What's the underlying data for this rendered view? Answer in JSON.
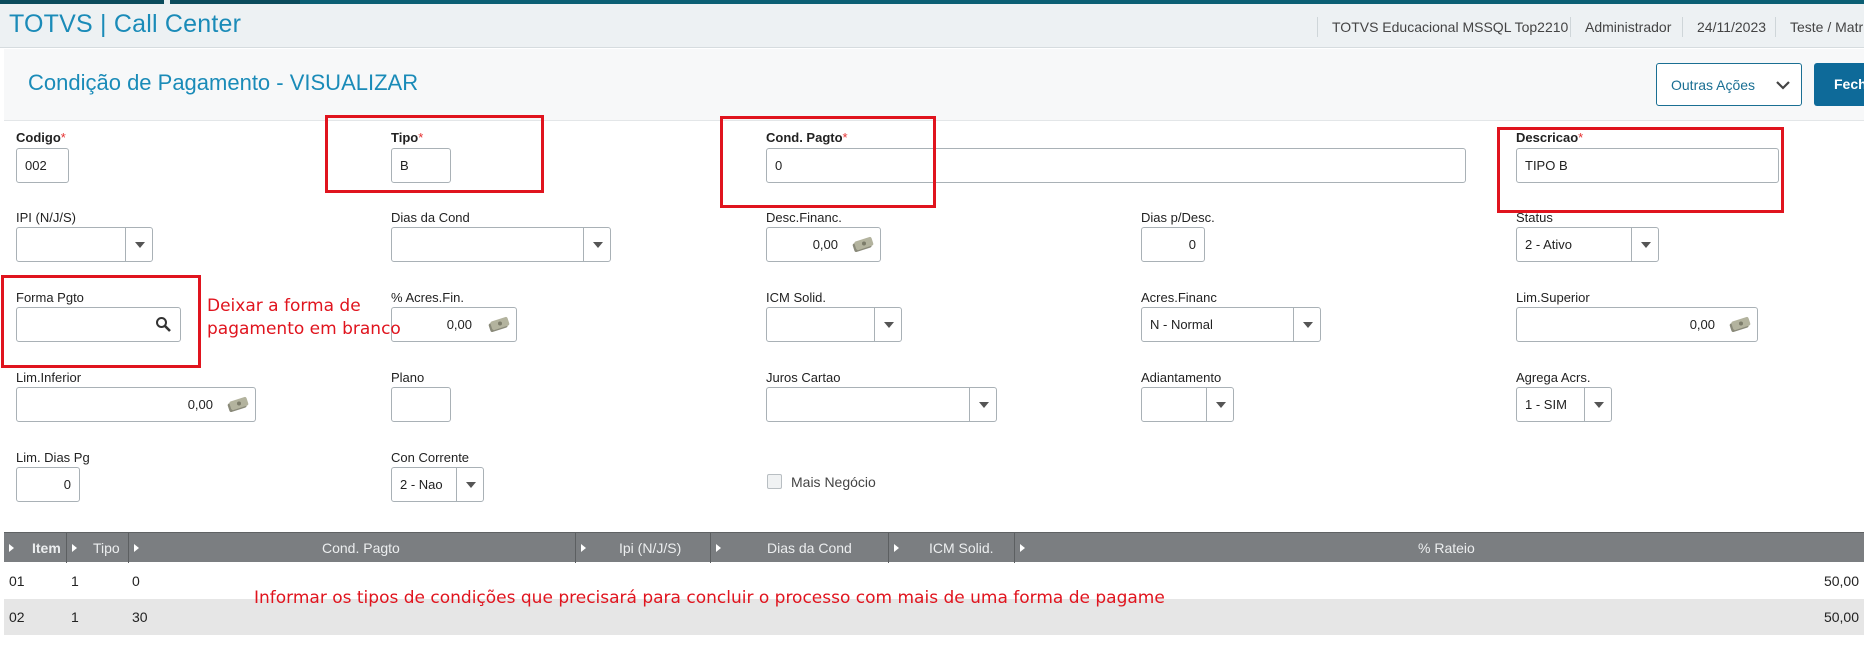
{
  "app": {
    "title": "TOTVS | Call Center",
    "environment": "TOTVS Educacional MSSQL Top2210",
    "user": "Administrador",
    "date": "24/11/2023",
    "branch": "Teste / Matri"
  },
  "page": {
    "title": "Condição de Pagamento - VISUALIZAR",
    "outras_acoes_label": "Outras Ações",
    "fechar_label": "Fechar"
  },
  "form": {
    "codigo": {
      "label": "Codigo",
      "value": "002"
    },
    "tipo": {
      "label": "Tipo",
      "value": "B"
    },
    "cond_pagto": {
      "label": "Cond. Pagto",
      "value": "0"
    },
    "descricao": {
      "label": "Descricao",
      "value": "TIPO B"
    },
    "ipi": {
      "label": "IPI (N/J/S)",
      "value": ""
    },
    "dias_cond": {
      "label": "Dias da Cond",
      "value": ""
    },
    "desc_financ": {
      "label": "Desc.Financ.",
      "value": "0,00"
    },
    "dias_desc": {
      "label": "Dias p/Desc.",
      "value": "0"
    },
    "status": {
      "label": "Status",
      "value": "2 - Ativo"
    },
    "forma_pgto": {
      "label": "Forma Pgto",
      "value": ""
    },
    "acres_fin": {
      "label": "% Acres.Fin.",
      "value": "0,00"
    },
    "icm_solid": {
      "label": "ICM Solid.",
      "value": ""
    },
    "acres_financ": {
      "label": "Acres.Financ",
      "value": "N - Normal"
    },
    "lim_superior": {
      "label": "Lim.Superior",
      "value": "0,00"
    },
    "lim_inferior": {
      "label": "Lim.Inferior",
      "value": "0,00"
    },
    "plano": {
      "label": "Plano",
      "value": ""
    },
    "juros_cartao": {
      "label": "Juros Cartao",
      "value": ""
    },
    "adiantamento": {
      "label": "Adiantamento",
      "value": ""
    },
    "agrega_acrs": {
      "label": "Agrega Acrs.",
      "value": "1 - SIM"
    },
    "lim_dias_pg": {
      "label": "Lim. Dias Pg",
      "value": "0"
    },
    "con_corrente": {
      "label": "Con Corrente",
      "value": "2 - Nao"
    },
    "mais_negocio": {
      "label": "Mais Negócio",
      "checked": false
    }
  },
  "annotations": {
    "forma_pgto_line1": "Deixar a forma de",
    "forma_pgto_line2": "pagamento em branco",
    "grid_note": "Informar os tipos de condições que precisará para concluir  o processo com mais de uma forma de pagame"
  },
  "grid": {
    "columns": [
      "Item",
      "Tipo",
      "Cond. Pagto",
      "Ipi (N/J/S)",
      "Dias da Cond",
      "ICM Solid.",
      "% Rateio"
    ],
    "rows": [
      {
        "item": "01",
        "tipo": "1",
        "cond": "0",
        "rateio": "50,00"
      },
      {
        "item": "02",
        "tipo": "1",
        "cond": "30",
        "rateio": "50,00"
      }
    ]
  },
  "colors": {
    "accent": "#1a8bb8",
    "primary_button": "#0e6a99",
    "annotation_red": "#e0141e",
    "grid_header": "#7b7e81"
  }
}
